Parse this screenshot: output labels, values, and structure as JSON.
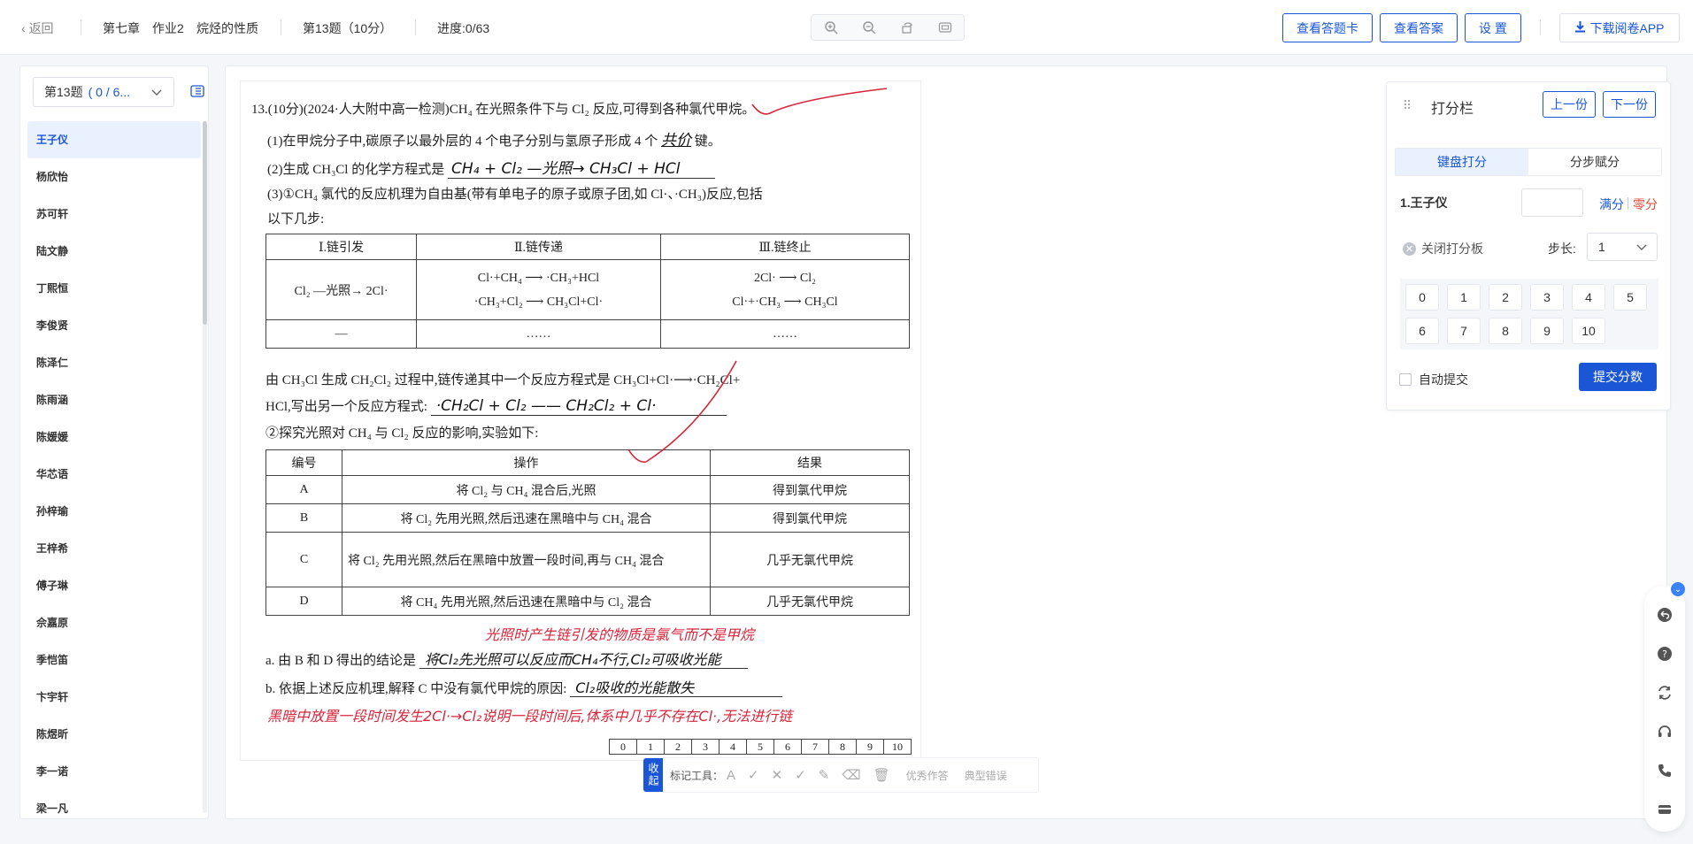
{
  "topbar": {
    "back_label": "返回",
    "chapter": "第七章",
    "homework": "作业2",
    "topic": "烷烃的性质",
    "question": "第13题（10分）",
    "progress": "进度:0/63",
    "view_card": "查看答题卡",
    "view_answer": "查看答案",
    "settings": "设 置",
    "download": "下载阅卷APP"
  },
  "left": {
    "question_select": "第13题",
    "question_progress": "( 0 / 6...",
    "students": [
      "王子仪",
      "杨欣怡",
      "苏可轩",
      "陆文静",
      "丁熙恒",
      "李俊贤",
      "陈泽仁",
      "陈雨涵",
      "陈媛媛",
      "华芯语",
      "孙梓瑜",
      "王梓希",
      "傅子琳",
      "佘嘉原",
      "季恺笛",
      "卞宇轩",
      "陈煜昕",
      "李一诺",
      "梁一凡"
    ]
  },
  "sheet": {
    "q_line1": "13.(10分)(2024·人大附中高一检测)CH₄ 在光照条件下与 Cl₂ 反应,可得到各种氯代甲烷。",
    "q_line2": "(1)在甲烷分子中,碳原子以最外层的 4 个电子分别与氢原子形成 4 个",
    "q_line2b": "键。",
    "hw_1": "共价",
    "q_line3": "(2)生成 CH₃Cl 的化学方程式是",
    "hw_2": "CH₄ + Cl₂ —光照→ CH₃Cl + HCl",
    "q_line4": "(3)①CH₄ 氯代的反应机理为自由基(带有单电子的原子或原子团,如 Cl·、·CH₃)反应,包括",
    "q_line5": "以下几步:",
    "mech_headers": [
      "Ⅰ.链引发",
      "Ⅱ.链传递",
      "Ⅲ.链终止"
    ],
    "mech_row1": [
      "Cl₂ —光照→ 2Cl·",
      "Cl·+CH₄ ⟶ ·CH₃+HCl",
      "2Cl· ⟶ Cl₂"
    ],
    "mech_row1b": [
      "",
      "·CH₃+Cl₂ ⟶ CH₃Cl+Cl·",
      "Cl·+·CH₃ ⟶ CH₃Cl"
    ],
    "mech_row2": [
      "—",
      "……",
      "……"
    ],
    "q_line6": "由 CH₃Cl 生成 CH₂Cl₂ 过程中,链传递其中一个反应方程式是 CH₃Cl+Cl·⟶·CH₂Cl+",
    "q_line7": "HCl,写出另一个反应方程式:",
    "hw_3": "·CH₂Cl + Cl₂ —— CH₂Cl₂ + Cl·",
    "q_line8": "②探究光照对 CH₄ 与 Cl₂ 反应的影响,实验如下:",
    "exp_headers": [
      "编号",
      "操作",
      "结果"
    ],
    "exp_rows": [
      [
        "A",
        "将 Cl₂ 与 CH₄ 混合后,光照",
        "得到氯代甲烷"
      ],
      [
        "B",
        "将 Cl₂ 先用光照,然后迅速在黑暗中与 CH₄ 混合",
        "得到氯代甲烷"
      ],
      [
        "C",
        "将 Cl₂ 先用光照,然后在黑暗中放置一段时间,再与 CH₄ 混合",
        "几乎无氯代甲烷"
      ],
      [
        "D",
        "将 CH₄ 先用光照,然后迅速在黑暗中与 Cl₂ 混合",
        "几乎无氯代甲烷"
      ]
    ],
    "hw_red_1": "光照时产生链引发的物质是氯气而不是甲烷",
    "q_line9": "a. 由 B 和 D 得出的结论是",
    "hw_4": "将Cl₂先光照可以反应而CH₄不行,Cl₂可吸收光能",
    "q_line10": "b. 依据上述反应机理,解释 C 中没有氯代甲烷的原因:",
    "hw_5": "Cl₂吸收的光能散失",
    "hw_red_2": "黑暗中放置一段时间发生2Cl·→Cl₂说明一段时间后,体系中几乎不存在Cl·,无法进行链",
    "score_boxes": [
      "0",
      "1",
      "2",
      "3",
      "4",
      "5",
      "6",
      "7",
      "8",
      "9",
      "10"
    ]
  },
  "marktools": {
    "collapse": "收起",
    "label": "标记工具：",
    "excellent": "优秀作答",
    "typical_error": "典型错误"
  },
  "scorepanel": {
    "title": "打分栏",
    "prev": "上一份",
    "next": "下一份",
    "tab_keyboard": "键盘打分",
    "tab_step": "分步赋分",
    "student": "1.王子仪",
    "score_value": "",
    "full": "满分",
    "zero": "零分",
    "close_board": "关闭打分板",
    "step_label": "步长:",
    "step_value": "1",
    "keys": [
      "0",
      "1",
      "2",
      "3",
      "4",
      "5",
      "6",
      "7",
      "8",
      "9",
      "10"
    ],
    "auto_submit": "自动提交",
    "submit": "提交分数"
  },
  "colors": {
    "accent": "#1a56d6",
    "zero_red": "#e04b3a",
    "ink_red": "#d8243a"
  }
}
